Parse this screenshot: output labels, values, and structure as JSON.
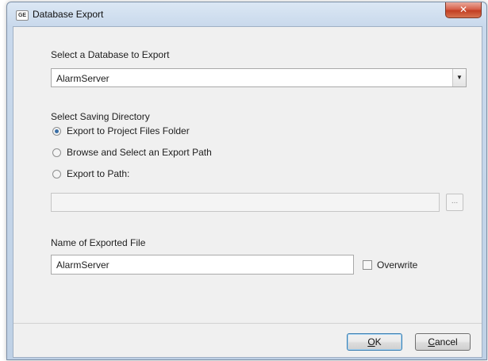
{
  "window": {
    "title": "Database Export",
    "app_icon_text": "GE",
    "close_glyph": "✕"
  },
  "database": {
    "label": "Select a Database to Export",
    "selected": "AlarmServer",
    "dropdown_icon": "chevron-down-icon"
  },
  "directory": {
    "label": "Select Saving Directory",
    "options": [
      {
        "label": "Export to Project Files Folder",
        "checked": true
      },
      {
        "label": "Browse and Select an Export Path",
        "checked": false
      },
      {
        "label": "Export to Path:",
        "checked": false
      }
    ],
    "path_value": "",
    "browse_label": "..."
  },
  "file": {
    "label": "Name of Exported File",
    "value": "AlarmServer",
    "overwrite_label": "Overwrite",
    "overwrite_checked": false
  },
  "buttons": {
    "ok_mnemonic": "O",
    "ok_rest": "K",
    "cancel_mnemonic": "C",
    "cancel_rest": "ancel"
  }
}
